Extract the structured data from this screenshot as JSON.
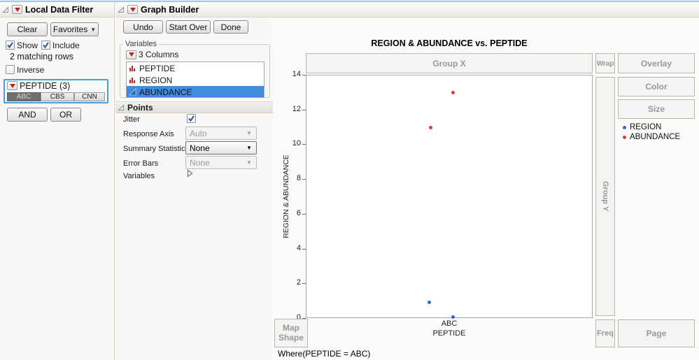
{
  "colors": {
    "selection_blue": "#3e8edd",
    "filter_highlight_border": "#4f9be0",
    "point_blue": "#3b66c4",
    "point_red": "#df3b32"
  },
  "local_data_filter": {
    "title": "Local Data Filter",
    "clear_label": "Clear",
    "favorites_label": "Favorites",
    "show_label": "Show",
    "include_label": "Include",
    "matching_rows": "2 matching rows",
    "inverse_label": "Inverse",
    "filter": {
      "name": "PEPTIDE (3)",
      "levels": [
        "ABC",
        "CBS",
        "CNN"
      ],
      "selected_level": "ABC"
    },
    "and_label": "AND",
    "or_label": "OR"
  },
  "graph_builder": {
    "title": "Graph Builder",
    "buttons": {
      "undo": "Undo",
      "start_over": "Start Over",
      "done": "Done"
    },
    "toolbar_icons": [
      "points",
      "smoother",
      "line-of-fit",
      "ellipse",
      "contour",
      "line",
      "bar",
      "area",
      "box-plot",
      "histogram",
      "heatmap",
      "pie",
      "treemap",
      "mosaic",
      "caption-box",
      "formula",
      "map-shapes",
      "parallel"
    ],
    "toolbar_selected": "points",
    "variables_box": {
      "label": "Variables",
      "columns_label": "3 Columns",
      "items": [
        {
          "label": "PEPTIDE",
          "type": "nominal"
        },
        {
          "label": "REGION",
          "type": "nominal"
        },
        {
          "label": "ABUNDANCE",
          "type": "continuous"
        }
      ]
    },
    "points_panel": {
      "title": "Points",
      "jitter_label": "Jitter",
      "jitter_checked": true,
      "response_axis_label": "Response Axis",
      "response_axis_value": "Auto",
      "summary_statistic_label": "Summary Statistic",
      "summary_statistic_value": "None",
      "error_bars_label": "Error Bars",
      "error_bars_value": "None",
      "variables_label": "Variables"
    }
  },
  "graph": {
    "title": "REGION & ABUNDANCE vs. PEPTIDE",
    "zones": {
      "group_x": "Group X",
      "wrap": "Wrap",
      "overlay": "Overlay",
      "group_y": "Group Y",
      "color": "Color",
      "size": "Size",
      "map_shape": "Map Shape",
      "freq": "Freq",
      "page": "Page"
    },
    "legend": [
      {
        "label": "REGION",
        "color": "#3b66c4"
      },
      {
        "label": "ABUNDANCE",
        "color": "#df3b32"
      }
    ],
    "where_clause": "Where(PEPTIDE = ABC)"
  },
  "chart_data": {
    "type": "scatter",
    "title": "REGION & ABUNDANCE vs. PEPTIDE",
    "xlabel": "PEPTIDE",
    "ylabel": "REGION & ABUNDANCE",
    "x_categories": [
      "ABC"
    ],
    "ylim": [
      0,
      14
    ],
    "y_ticks": [
      0,
      2,
      4,
      6,
      8,
      10,
      12,
      14
    ],
    "grid": false,
    "jitter": true,
    "legend_position": "right",
    "series": [
      {
        "name": "REGION",
        "color": "#3b66c4",
        "points": [
          {
            "x": "ABC",
            "y": 0.95,
            "xfrac": 0.427
          },
          {
            "x": "ABC",
            "y": 0.1,
            "xfrac": 0.51
          }
        ]
      },
      {
        "name": "ABUNDANCE",
        "color": "#df3b32",
        "points": [
          {
            "x": "ABC",
            "y": 11,
            "xfrac": 0.432
          },
          {
            "x": "ABC",
            "y": 13,
            "xfrac": 0.51
          }
        ]
      }
    ]
  }
}
